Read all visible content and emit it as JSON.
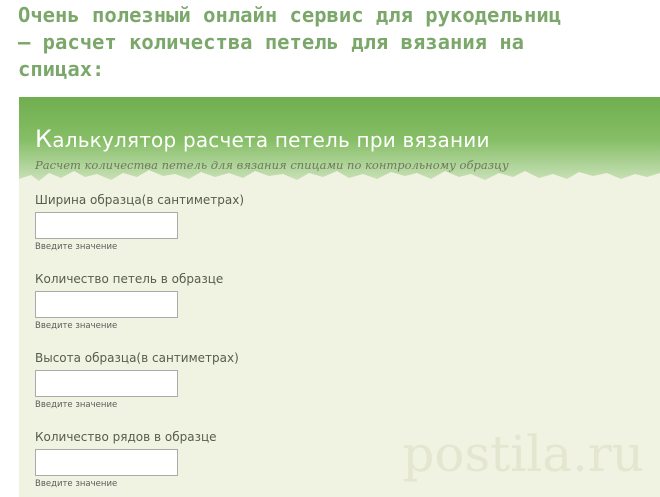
{
  "headline": {
    "line1": "Очень полезный онлайн сервис для рукодельниц",
    "line2": "– расчет количества петель для вязания на",
    "line3": "спицах:"
  },
  "calculator": {
    "title_first": "К",
    "title_rest": "алькулятор расчета петель при вязании",
    "subtitle": "Расчет количества петель для вязания спицами по контрольному образцу",
    "fields": [
      {
        "label": "Ширина образца(в сантиметрах)",
        "value": "",
        "hint": "Введите значение"
      },
      {
        "label": "Количество петель в образце",
        "value": "",
        "hint": "Введите значение"
      },
      {
        "label": "Высота образца(в сантиметрах)",
        "value": "",
        "hint": "Введите значение"
      },
      {
        "label": "Количество рядов в образце",
        "value": "",
        "hint": "Введите значение"
      }
    ]
  },
  "watermark": "postila.ru",
  "colors": {
    "headline": "#7ba76a",
    "header_green": "#6fae4f",
    "panel_background": "#f1f3e2"
  }
}
